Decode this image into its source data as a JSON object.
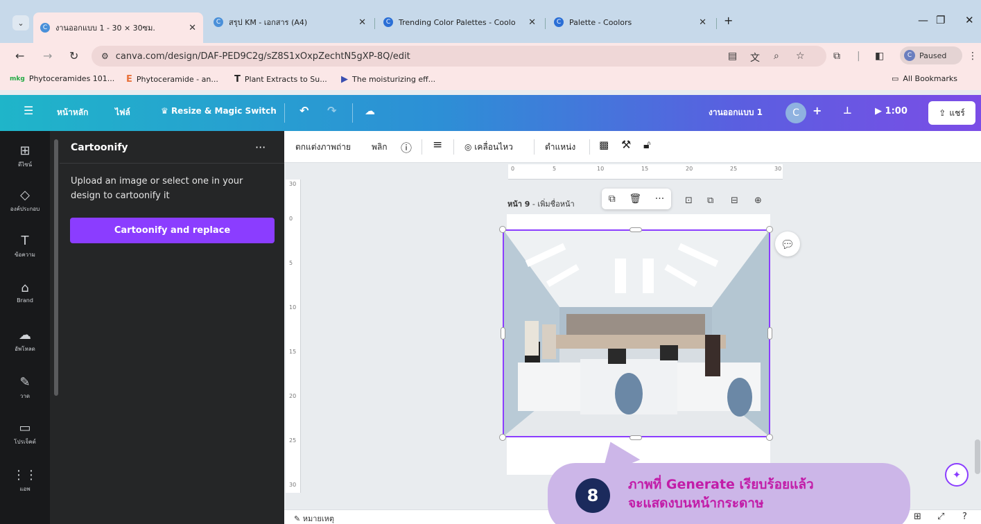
{
  "browser": {
    "tabs": [
      {
        "title": "งานออกแบบ 1 - 30 × 30ซม.",
        "active": true
      },
      {
        "title": "สรุป KM - เอกสาร (A4)",
        "active": false
      },
      {
        "title": "Trending Color Palettes - Coolo",
        "active": false
      },
      {
        "title": "Palette - Coolors",
        "active": false
      }
    ],
    "new_tab": "+",
    "url": "canva.com/design/DAF-PED9C2g/sZ8S1xOxpZechtN5gXP-8Q/edit",
    "paused_label": "Paused",
    "profile_initial": "C",
    "bookmarks": [
      {
        "icon": "mkg",
        "label": "Phytoceramides 101..."
      },
      {
        "icon": "E",
        "label": "Phytoceramide - an..."
      },
      {
        "icon": "T",
        "label": "Plant Extracts to Su..."
      },
      {
        "icon": "▶",
        "label": "The moisturizing eff..."
      }
    ],
    "all_bookmarks": "All Bookmarks"
  },
  "canva": {
    "home": "หน้าหลัก",
    "file": "ไฟล์",
    "resize": "Resize & Magic Switch",
    "design_name": "งานออกแบบ 1",
    "avatar_initial": "C",
    "play_time": "1:00",
    "share": "แชร์",
    "rail": [
      {
        "icon": "⊞",
        "label": "ดีไซน์"
      },
      {
        "icon": "◇",
        "label": "องค์ประกอบ"
      },
      {
        "icon": "T",
        "label": "ข้อความ"
      },
      {
        "icon": "⌂",
        "label": "Brand"
      },
      {
        "icon": "☁",
        "label": "อัพโหลด"
      },
      {
        "icon": "✎",
        "label": "วาด"
      },
      {
        "icon": "▭",
        "label": "โปรเจ็คต์"
      },
      {
        "icon": "⋮⋮",
        "label": "แอพ"
      }
    ],
    "panel": {
      "title": "Cartoonify",
      "more": "···",
      "description": "Upload an image or select one in your design to cartoonify it",
      "button": "Cartoonify and replace"
    },
    "toolbar": {
      "edit_photo": "ตกแต่งภาพถ่าย",
      "flip": "พลิก",
      "animate": "เคลื่อนไหว",
      "position": "ตำแหน่ง"
    },
    "page_label_bold": "หน้า 9",
    "page_label_rest": " - เพิ่มชื่อหน้า",
    "ruler_top": [
      "0",
      "5",
      "10",
      "15",
      "20",
      "25",
      "30"
    ],
    "ruler_left": [
      "30",
      "0",
      "5",
      "10",
      "15",
      "20",
      "25",
      "30"
    ],
    "notes": "หมายเหตุ"
  },
  "callout": {
    "step": "8",
    "line1": "ภาพที่ Generate เรียบร้อยแล้ว",
    "line2": "จะแสดงบนหน้ากระดาษ"
  },
  "colors": {
    "canva_gradient_start": "#1fb5c9",
    "canva_gradient_end": "#7b4de6",
    "accent_purple": "#8b3dff",
    "callout_bg": "#ccb6e8",
    "callout_text": "#c21ca8",
    "badge_bg": "#1b2a5c"
  }
}
